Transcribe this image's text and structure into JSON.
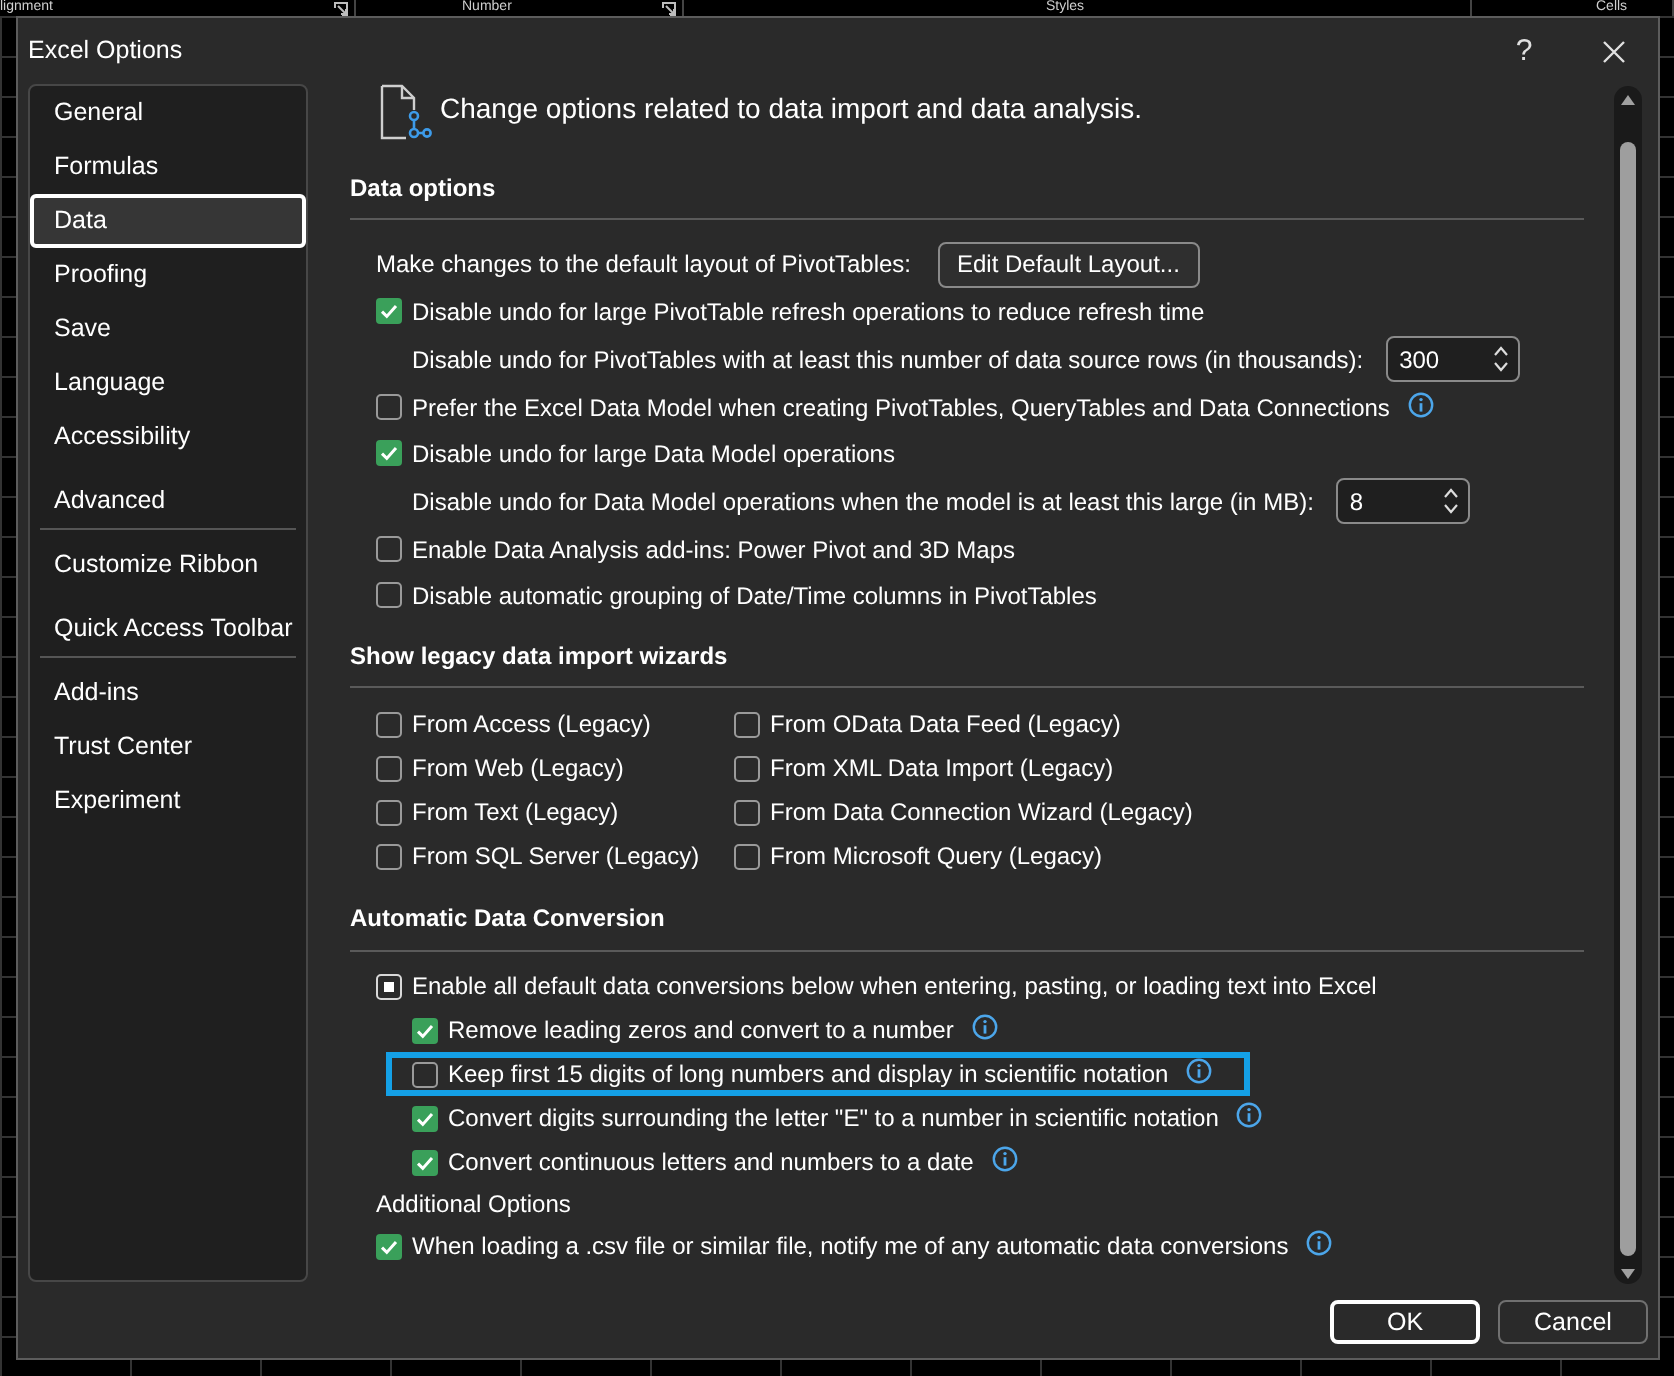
{
  "background": {
    "ribbon_groups": [
      {
        "label": "lignment",
        "launcher": true
      },
      {
        "label": "Number",
        "launcher": true
      },
      {
        "label": "Styles",
        "launcher": false
      },
      {
        "label": "Cells",
        "launcher": false
      }
    ]
  },
  "window": {
    "title": "Excel Options",
    "help": "?"
  },
  "sidebar": {
    "groups": [
      {
        "items": [
          {
            "label": "General",
            "selected": false
          },
          {
            "label": "Formulas",
            "selected": false
          },
          {
            "label": "Data",
            "selected": true
          },
          {
            "label": "Proofing",
            "selected": false
          },
          {
            "label": "Save",
            "selected": false
          },
          {
            "label": "Language",
            "selected": false
          },
          {
            "label": "Accessibility",
            "selected": false
          },
          {
            "label": "Advanced",
            "selected": false
          }
        ]
      },
      {
        "items": [
          {
            "label": "Customize Ribbon",
            "selected": false
          },
          {
            "label": "Quick Access Toolbar",
            "selected": false
          }
        ]
      },
      {
        "items": [
          {
            "label": "Add-ins",
            "selected": false
          },
          {
            "label": "Trust Center",
            "selected": false
          },
          {
            "label": "Experiment",
            "selected": false
          }
        ]
      }
    ]
  },
  "page_header": {
    "text": "Change options related to data import and data analysis."
  },
  "sections": [
    {
      "title": "Data options",
      "kind": "list",
      "rows": [
        {
          "kind": "button",
          "label": "Make changes to the default layout of PivotTables:",
          "button": "Edit Default Layout..."
        },
        {
          "kind": "checkbox",
          "label": "Disable undo for large PivotTable refresh operations to reduce refresh time",
          "checked": true,
          "info": false,
          "children": [
            {
              "kind": "spinner",
              "label": "Disable undo for PivotTables with at least this number of data source rows (in thousands):",
              "value": "300"
            }
          ]
        },
        {
          "kind": "checkbox",
          "label": "Prefer the Excel Data Model when creating PivotTables, QueryTables and Data Connections",
          "checked": false,
          "info": true
        },
        {
          "kind": "checkbox",
          "label": "Disable undo for large Data Model operations",
          "checked": true,
          "info": false,
          "children": [
            {
              "kind": "spinner",
              "label": "Disable undo for Data Model operations when the model is at least this large (in MB):",
              "value": "8"
            }
          ]
        },
        {
          "kind": "checkbox",
          "label": "Enable Data Analysis add-ins: Power Pivot and 3D Maps",
          "checked": false,
          "info": false
        },
        {
          "kind": "checkbox",
          "label": "Disable automatic grouping of Date/Time columns in PivotTables",
          "checked": false,
          "info": false
        }
      ]
    },
    {
      "title": "Show legacy data import wizards",
      "kind": "grid",
      "rows": [
        {
          "kind": "checkbox",
          "label": "From Access (Legacy)",
          "checked": false
        },
        {
          "kind": "checkbox",
          "label": "From OData Data Feed (Legacy)",
          "checked": false
        },
        {
          "kind": "checkbox",
          "label": "From Web (Legacy)",
          "checked": false
        },
        {
          "kind": "checkbox",
          "label": "From XML Data Import (Legacy)",
          "checked": false
        },
        {
          "kind": "checkbox",
          "label": "From Text (Legacy)",
          "checked": false
        },
        {
          "kind": "checkbox",
          "label": "From Data Connection Wizard (Legacy)",
          "checked": false
        },
        {
          "kind": "checkbox",
          "label": "From SQL Server (Legacy)",
          "checked": false
        },
        {
          "kind": "checkbox",
          "label": "From Microsoft Query (Legacy)",
          "checked": false
        }
      ]
    },
    {
      "title": "Automatic Data Conversion",
      "kind": "list",
      "rows": [
        {
          "kind": "checkbox",
          "label": "Enable all default data conversions below when entering, pasting, or loading text into Excel",
          "indeterminate": true,
          "info": false,
          "children": [
            {
              "kind": "checkbox",
              "label": "Remove leading zeros and convert to a number",
              "checked": true,
              "info": true,
              "highlighted": false
            },
            {
              "kind": "checkbox",
              "label": "Keep first 15 digits of long numbers and display in scientific notation",
              "checked": false,
              "info": true,
              "highlighted": true
            },
            {
              "kind": "checkbox",
              "label": "Convert digits surrounding the letter \"E\" to a number in scientific notation",
              "checked": true,
              "info": true,
              "highlighted": false
            },
            {
              "kind": "checkbox",
              "label": "Convert continuous letters and numbers to a date",
              "checked": true,
              "info": true,
              "highlighted": false
            }
          ]
        },
        {
          "kind": "subheading",
          "label": "Additional Options"
        },
        {
          "kind": "checkbox",
          "label": "When loading a .csv file or similar file, notify me of any automatic data conversions",
          "checked": true,
          "indeterminate": false,
          "info": true
        }
      ]
    }
  ],
  "buttons": [
    {
      "label": "OK",
      "focused": true
    },
    {
      "label": "Cancel",
      "focused": false
    }
  ]
}
